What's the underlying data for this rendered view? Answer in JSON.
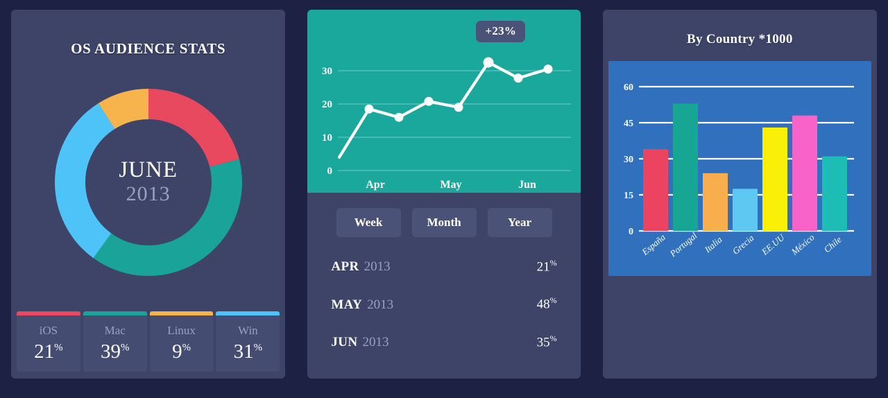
{
  "os_panel": {
    "title": "OS AUDIENCE STATS",
    "center_month": "JUNE",
    "center_year": "2013",
    "legend": [
      {
        "name": "iOS",
        "value": "21",
        "suffix": "%",
        "color": "#e8495f"
      },
      {
        "name": "Mac",
        "value": "39",
        "suffix": "%",
        "color": "#1aa398"
      },
      {
        "name": "Linux",
        "value": "9",
        "suffix": "%",
        "color": "#f7b34c"
      },
      {
        "name": "Win",
        "value": "31",
        "suffix": "%",
        "color": "#4ec3f7"
      }
    ]
  },
  "trend_panel": {
    "badge": "+23%",
    "buttons": [
      {
        "label": "Week"
      },
      {
        "label": "Month"
      },
      {
        "label": "Year"
      }
    ],
    "months": [
      {
        "name": "APR",
        "year": "2013",
        "value": "21",
        "suffix": "%"
      },
      {
        "name": "MAY",
        "year": "2013",
        "value": "48",
        "suffix": "%"
      },
      {
        "name": "JUN",
        "year": "2013",
        "value": "35",
        "suffix": "%"
      }
    ]
  },
  "country_panel": {
    "title": "By Country *1000"
  },
  "colors": {
    "page_bg": "#1d2244",
    "panel_bg": "#3d4468",
    "line_chart_bg": "#1aa79c",
    "bar_chart_bg": "#3070bd",
    "badge_bg": "#4b5277",
    "button_bg": "#4b5277",
    "text_primary": "#ffffff",
    "text_muted": "#9aa0c0"
  },
  "chart_data": [
    {
      "type": "pie",
      "title": "OS AUDIENCE STATS",
      "subtitle": "JUNE 2013",
      "donut": true,
      "labels": [
        "iOS",
        "Mac",
        "Win",
        "Linux"
      ],
      "values": [
        21,
        39,
        31,
        9
      ],
      "colors": [
        "#e8495f",
        "#1aa398",
        "#4ec3f7",
        "#f7b34c"
      ],
      "unit": "%",
      "start_angle": 0,
      "direction": "clockwise",
      "legend": "bottom"
    },
    {
      "type": "line",
      "title": "",
      "xlabel": "",
      "ylabel": "",
      "ylim": [
        0,
        35
      ],
      "yticks": [
        0,
        10,
        20,
        30
      ],
      "grid": true,
      "annotation": "+23%",
      "x_tick_labels": [
        "Apr",
        "May",
        "Jun"
      ],
      "x": [
        0,
        1,
        2,
        3,
        4,
        5,
        6,
        7
      ],
      "values": [
        4,
        18.5,
        16,
        20.8,
        19,
        32.5,
        27.8,
        30.5
      ],
      "markers": [
        false,
        true,
        true,
        true,
        true,
        true,
        true,
        true
      ],
      "line_color": "#ffffff",
      "bg_color": "#1aa79c",
      "legend_position": "none"
    },
    {
      "type": "bar",
      "title": "By Country *1000",
      "categories": [
        "España",
        "Portugal",
        "Italia",
        "Grecia",
        "EE.UU",
        "México",
        "Chile"
      ],
      "values": [
        34,
        53,
        24,
        17.5,
        43,
        48,
        31
      ],
      "colors": [
        "#ec4360",
        "#17a693",
        "#f9ae4d",
        "#5ec8f2",
        "#faef07",
        "#f763c8",
        "#1dbdb5"
      ],
      "xlabel": "",
      "ylabel": "",
      "ylim": [
        0,
        65
      ],
      "yticks": [
        0,
        15,
        30,
        45,
        60
      ],
      "grid": true,
      "bg_color": "#3070bd",
      "legend_position": "none"
    }
  ]
}
